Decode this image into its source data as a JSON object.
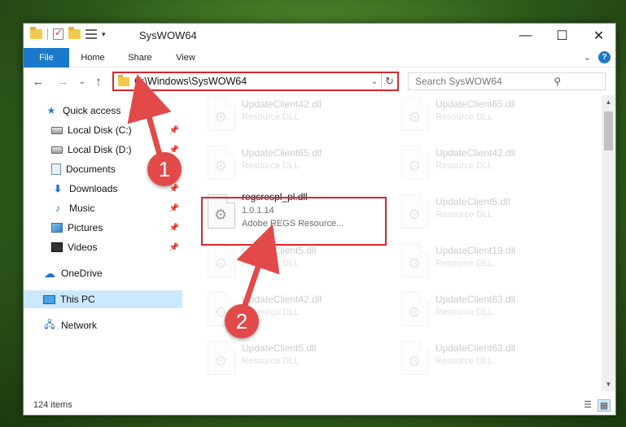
{
  "window": {
    "title": "SysWOW64",
    "minimize_glyph": "—",
    "maximize_glyph": "☐",
    "close_glyph": "✕"
  },
  "ribbon": {
    "tabs": [
      "File",
      "Home",
      "Share",
      "View"
    ],
    "expand_glyph": "⌄",
    "help_glyph": "?"
  },
  "navigation": {
    "back_glyph": "←",
    "forward_glyph": "→",
    "recent_glyph": "⌄",
    "up_glyph": "↑",
    "address_path": "C:\\Windows\\SysWOW64",
    "address_dropdown_glyph": "⌄",
    "refresh_glyph": "↻",
    "search_placeholder": "Search SysWOW64",
    "search_icon_glyph": "⚲"
  },
  "sidebar": {
    "items": [
      {
        "label": "Quick access",
        "icon": "star-icon"
      },
      {
        "label": "Local Disk (C:)",
        "icon": "drive-icon",
        "pinned": true
      },
      {
        "label": "Local Disk (D:)",
        "icon": "drive-icon",
        "pinned": true
      },
      {
        "label": "Documents",
        "icon": "documents-icon",
        "pinned": true
      },
      {
        "label": "Downloads",
        "icon": "download-icon",
        "pinned": true
      },
      {
        "label": "Music",
        "icon": "music-icon",
        "pinned": true
      },
      {
        "label": "Pictures",
        "icon": "pictures-icon",
        "pinned": true
      },
      {
        "label": "Videos",
        "icon": "videos-icon",
        "pinned": true
      },
      {
        "label": "OneDrive",
        "icon": "cloud-icon"
      },
      {
        "label": "This PC",
        "icon": "computer-icon",
        "selected": true
      },
      {
        "label": "Network",
        "icon": "network-icon"
      }
    ],
    "pin_glyph": "📌"
  },
  "files": [
    {
      "name": "UpdateClient42.dll",
      "desc": "Resource DLL"
    },
    {
      "name": "UpdateClient65.dll",
      "desc": "Resource DLL"
    },
    {
      "name": "UpdateClient65.dll",
      "desc": "Resource DLL"
    },
    {
      "name": "UpdateClient42.dll",
      "desc": "Resource DLL"
    },
    {
      "name": "regsrespl_pl.dll",
      "desc": "1.0.1.14",
      "extra": "Adobe REGS Resource...",
      "highlighted": true
    },
    {
      "name": "UpdateClient5.dll",
      "desc": "Resource DLL"
    },
    {
      "name": "UpdateClient5.dll",
      "desc": "Resource DLL"
    },
    {
      "name": "UpdateClient19.dll",
      "desc": "Resource DLL"
    },
    {
      "name": "UpdateClient42.dll",
      "desc": "Resource DLL"
    },
    {
      "name": "UpdateClient63.dll",
      "desc": "Resource DLL"
    },
    {
      "name": "UpdateClient5.dll",
      "desc": "Resource DLL"
    },
    {
      "name": "UpdateClient63.dll",
      "desc": "Resource DLL"
    }
  ],
  "status": {
    "item_count": "124 items"
  },
  "annotations": {
    "step1": "1",
    "step2": "2",
    "color": "#e24a4a"
  }
}
